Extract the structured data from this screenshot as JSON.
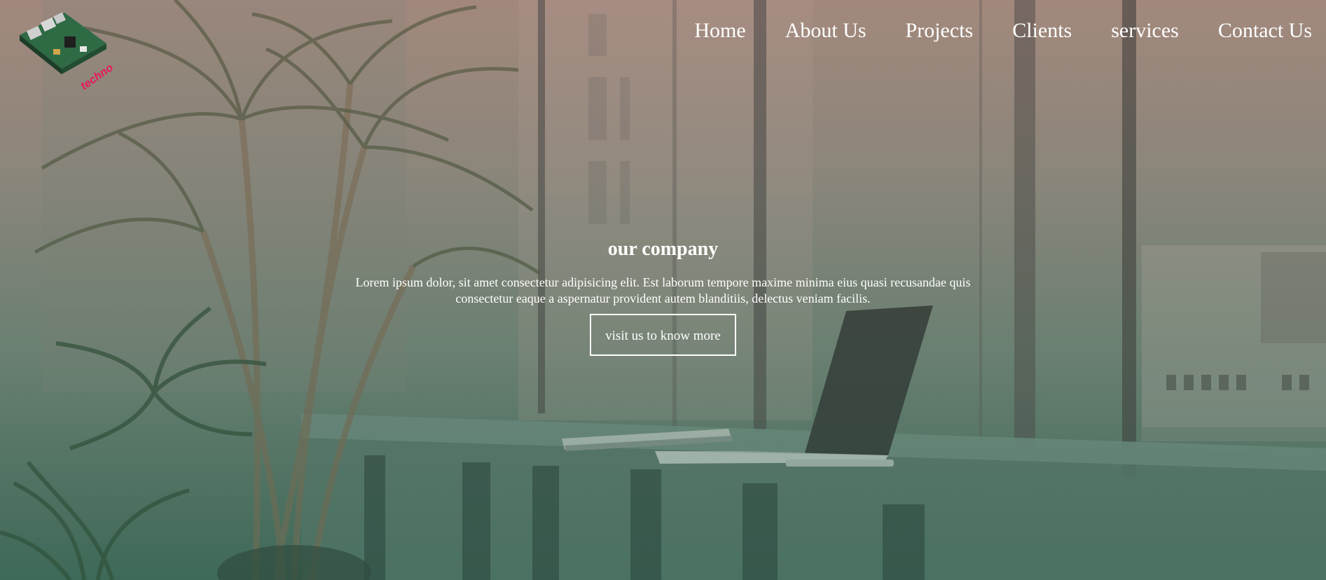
{
  "nav": {
    "items": [
      {
        "label": "Home"
      },
      {
        "label": "About Us"
      },
      {
        "label": "Projects"
      },
      {
        "label": "Clients"
      },
      {
        "label": "services"
      },
      {
        "label": "Contact Us"
      }
    ]
  },
  "hero": {
    "title": "our company",
    "description": "Lorem ipsum dolor, sit amet consectetur adipisicing elit. Est laborum tempore maxime minima eius quasi recusandae quis consectetur eaque a aspernatur provident autem blanditiis, delectus veniam facilis.",
    "cta_label": "visit us to know more"
  },
  "colors": {
    "text": "#ffffff",
    "logo_accent": "#e8185a"
  }
}
